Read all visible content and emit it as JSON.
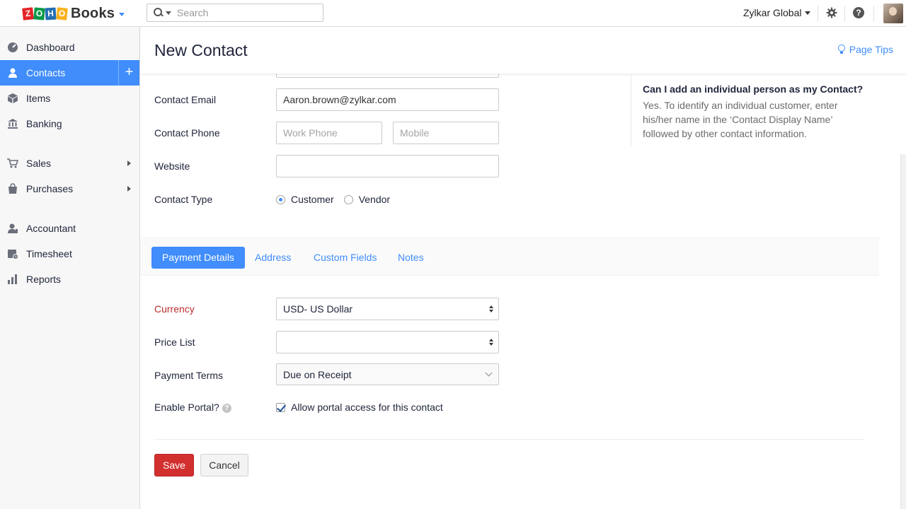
{
  "app": {
    "logo_letters": [
      "Z",
      "O",
      "H",
      "O"
    ],
    "product_name": "Books",
    "search_placeholder": "Search",
    "org_name": "Zylkar Global",
    "help_glyph": "?"
  },
  "sidebar": {
    "items": [
      {
        "label": "Dashboard",
        "icon": "dashboard-icon",
        "active": false
      },
      {
        "label": "Contacts",
        "icon": "contacts-icon",
        "active": true
      },
      {
        "label": "Items",
        "icon": "items-icon",
        "active": false
      },
      {
        "label": "Banking",
        "icon": "banking-icon",
        "active": false
      },
      {
        "label": "Sales",
        "icon": "sales-icon",
        "active": false,
        "submenu": true
      },
      {
        "label": "Purchases",
        "icon": "purchases-icon",
        "active": false,
        "submenu": true
      },
      {
        "label": "Accountant",
        "icon": "accountant-icon",
        "active": false
      },
      {
        "label": "Timesheet",
        "icon": "timesheet-icon",
        "active": false
      },
      {
        "label": "Reports",
        "icon": "reports-icon",
        "active": false
      }
    ],
    "add_glyph": "+"
  },
  "page": {
    "title": "New Contact",
    "page_tips": "Page Tips"
  },
  "form": {
    "contact_email": {
      "label": "Contact Email",
      "value": "Aaron.brown@zylkar.com"
    },
    "contact_phone": {
      "label": "Contact Phone",
      "work_placeholder": "Work Phone",
      "mobile_placeholder": "Mobile"
    },
    "website": {
      "label": "Website",
      "value": ""
    },
    "contact_type": {
      "label": "Contact Type",
      "options": [
        "Customer",
        "Vendor"
      ],
      "selected": "Customer"
    }
  },
  "help": {
    "question": "Can I add an individual person as my Contact?",
    "answer": "Yes. To identify an individual customer, enter his/her name in the ‘Contact Display Name’ followed by other contact information."
  },
  "tabs": [
    {
      "label": "Payment Details",
      "active": true
    },
    {
      "label": "Address",
      "active": false
    },
    {
      "label": "Custom Fields",
      "active": false
    },
    {
      "label": "Notes",
      "active": false
    }
  ],
  "payment": {
    "currency": {
      "label": "Currency",
      "value": "USD- US Dollar"
    },
    "price_list": {
      "label": "Price List",
      "value": ""
    },
    "payment_terms": {
      "label": "Payment Terms",
      "value": "Due on Receipt"
    },
    "portal": {
      "label": "Enable Portal?",
      "checkbox_label": "Allow portal access for this contact",
      "checked": true
    }
  },
  "actions": {
    "save": "Save",
    "cancel": "Cancel"
  },
  "colors": {
    "accent": "#408dfb",
    "save": "#d2302f",
    "required": "#b92d2d"
  }
}
